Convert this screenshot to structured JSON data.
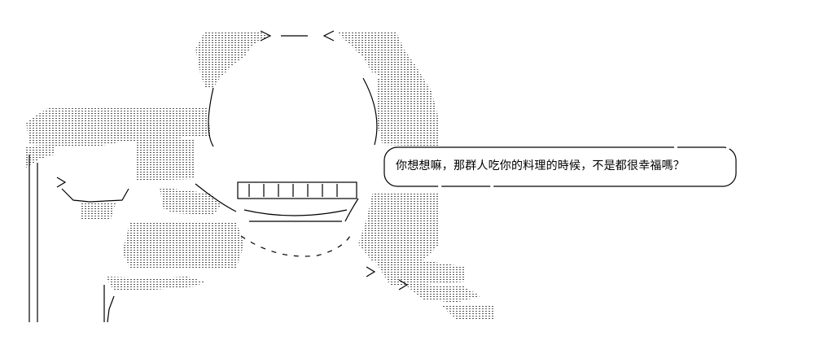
{
  "speech_bubble": {
    "text": "你想想嘛，那群人吃你的料理的時候，不是都很幸福嗎？"
  }
}
